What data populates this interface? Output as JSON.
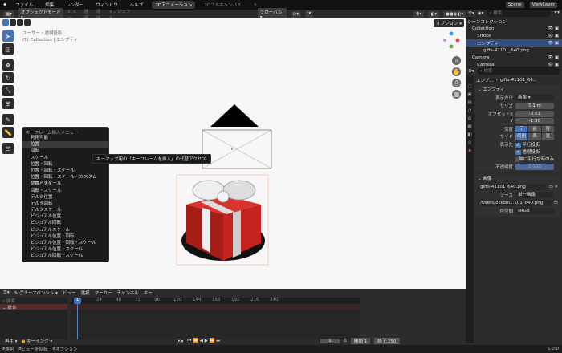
{
  "topbar": {
    "menus": [
      "ファイル",
      "編集",
      "レンダー",
      "ウィンドウ",
      "ヘルプ"
    ],
    "workspace_tabs": [
      "2Dアニメーション",
      "2Dフルキャンバス"
    ],
    "add_tab": "+",
    "scene": "Scene",
    "view_layer": "ViewLayer"
  },
  "viewport_header": {
    "mode": "オブジェクトモード",
    "menus": [
      "ビュー",
      "選択",
      "追加",
      "オブジェクト"
    ],
    "orientation": "グローバル",
    "options": "オプション"
  },
  "overlay_text": {
    "view": "ユーザー・透視投影",
    "object": "(1) Collection | エンプティ"
  },
  "keyframe_menu": {
    "title": "キーフレーム挿入メニュー",
    "items": [
      "利用可能",
      "位置",
      "回転",
      "スケール",
      "位置・回転",
      "位置・回転・スケール",
      "位置・回転・スケール・カスタムプロパティ",
      "位置・スケール",
      "回転・スケール",
      "デルタ位置",
      "デルタ回転",
      "デルタスケール",
      "ビジュアル位置",
      "ビジュアル回転",
      "ビジュアルスケール",
      "ビジュアル位置・回転",
      "ビジュアル位置・回転・スケール",
      "ビジュアル位置・スケール",
      "ビジュアル回転・スケール"
    ],
    "highlighted": 1,
    "tooltip": "キーマップ用の「キーフレームを挿入」の代替アクセス."
  },
  "outliner": {
    "search_placeholder": "検索",
    "items": [
      {
        "label": "シーンコレクション"
      },
      {
        "label": "Collection"
      },
      {
        "label": "Stroke"
      },
      {
        "label": "エンプティ",
        "selected": true
      },
      {
        "label": "gifts-41101_640.png"
      },
      {
        "label": "Camera"
      },
      {
        "label": "Camera"
      }
    ]
  },
  "properties": {
    "breadcrumb": [
      "エンプ...",
      "gifts-41101_64..."
    ],
    "section": "エンプティ",
    "display_as_label": "表示方法",
    "display_as": "画像",
    "size_label": "サイズ",
    "size": "5.1 m",
    "offset_x_label": "オフセットX",
    "offset_x": "-0.61",
    "offset_y_label": "Y",
    "offset_y": "-1.30",
    "depth_label": "深度",
    "depth_options": [
      "デフ...",
      "前",
      "背"
    ],
    "side_label": "サイド",
    "side_options": [
      "両側",
      "表",
      "裏"
    ],
    "show_label": "表示先",
    "show_options": [
      {
        "label": "平行投影",
        "checked": true
      },
      {
        "label": "透視投影",
        "checked": true
      },
      {
        "label": "軸に平行な時のみ",
        "checked": false
      }
    ],
    "opacity_label": "不透明度",
    "opacity": "1.000",
    "image_section": "画像",
    "image_name": "gifts-41101_640.png",
    "source_label": "ソース",
    "source": "単一画像",
    "filepath": "/Users/okkoin...101_640.png",
    "colorspace_label": "色空間",
    "colorspace": "sRGB"
  },
  "timeline": {
    "editor": "グリースペンシル",
    "menus": [
      "ビュー",
      "選択",
      "マーカー",
      "チャンネル",
      "キー"
    ],
    "search_placeholder": "検索",
    "channel": "総合",
    "ticks": [
      "24",
      "48",
      "72",
      "96",
      "120",
      "144",
      "168",
      "192",
      "216",
      "240"
    ],
    "current_frame": "1",
    "playback": "再生",
    "keying": "キーイング",
    "frame_field": "1",
    "start_label": "開始",
    "start": "1",
    "end_label": "終了",
    "end": "250"
  },
  "statusbar": {
    "items": [
      "選択",
      "ビューを回転",
      "オプション"
    ],
    "version": "5.0.0"
  },
  "colors": {
    "accent": "#4772b3",
    "selected_row": "#334d80",
    "gift_red": "#c4231f"
  }
}
